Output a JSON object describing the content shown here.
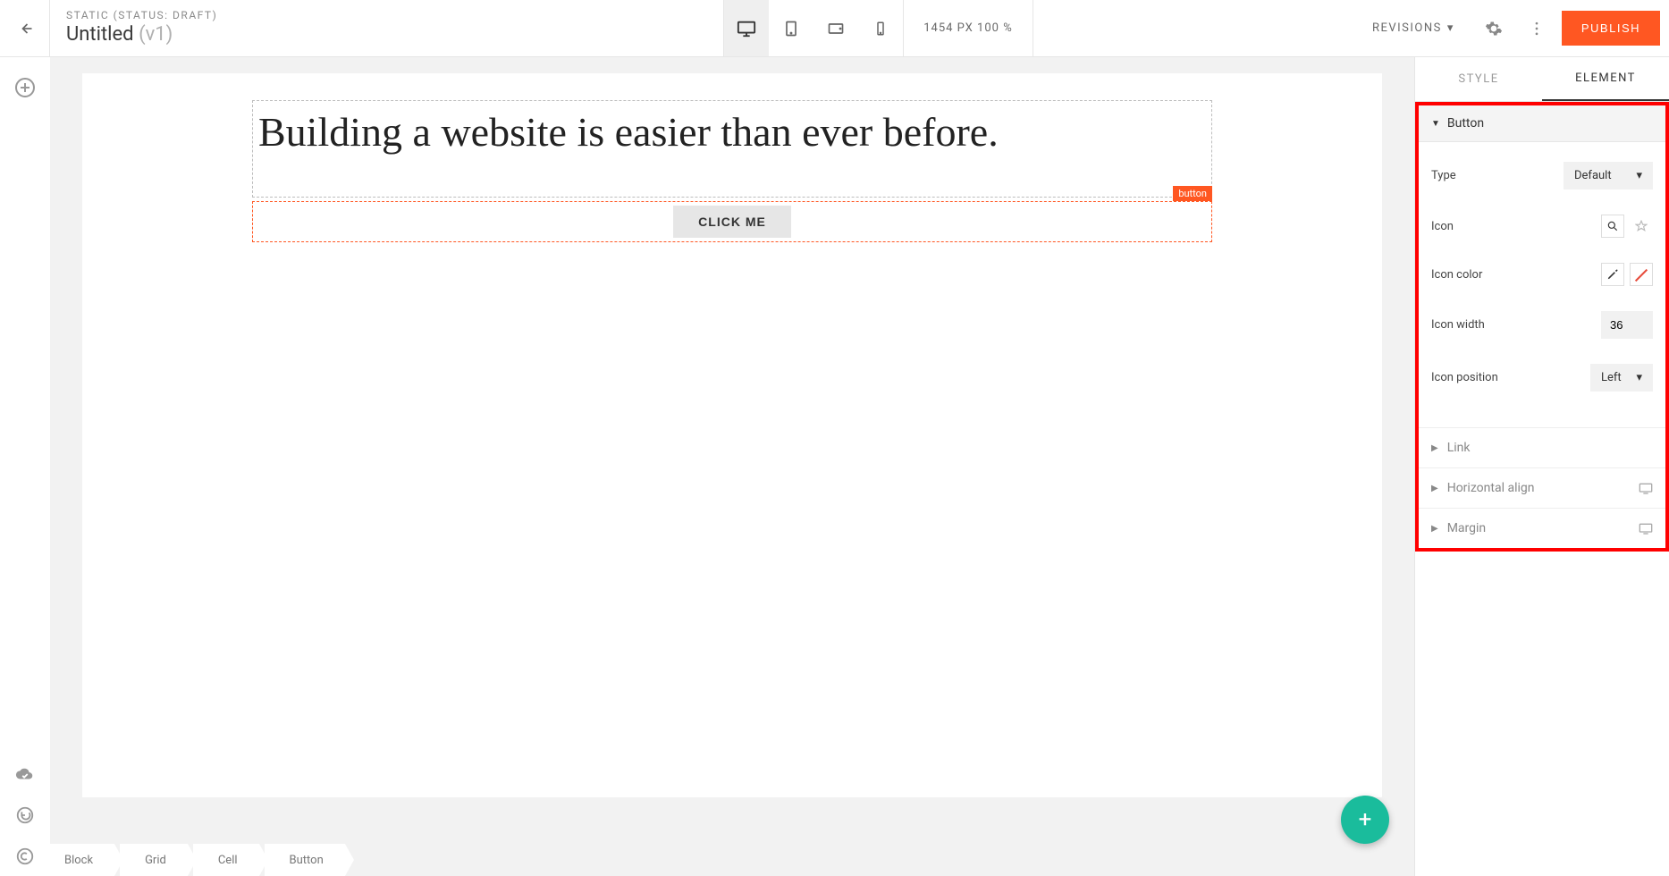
{
  "header": {
    "status_line": "STATIC (STATUS: DRAFT)",
    "title": "Untitled",
    "version": "(v1)",
    "viewport": "1454 PX  100 %",
    "revisions_label": "REVISIONS",
    "publish_label": "PUBLISH"
  },
  "canvas": {
    "heading_text": "Building a website is easier than ever before.",
    "button_text": "CLICK ME",
    "selection_tag": "button"
  },
  "breadcrumbs": [
    "Block",
    "Grid",
    "Cell",
    "Button"
  ],
  "panel": {
    "tabs": {
      "style": "STYLE",
      "element": "ELEMENT"
    },
    "active_tab": "element",
    "section_button": {
      "title": "Button",
      "type_label": "Type",
      "type_value": "Default",
      "icon_label": "Icon",
      "icon_color_label": "Icon color",
      "icon_width_label": "Icon width",
      "icon_width_value": "36",
      "icon_position_label": "Icon position",
      "icon_position_value": "Left"
    },
    "collapsed_sections": {
      "link": "Link",
      "halign": "Horizontal align",
      "margin": "Margin"
    }
  }
}
